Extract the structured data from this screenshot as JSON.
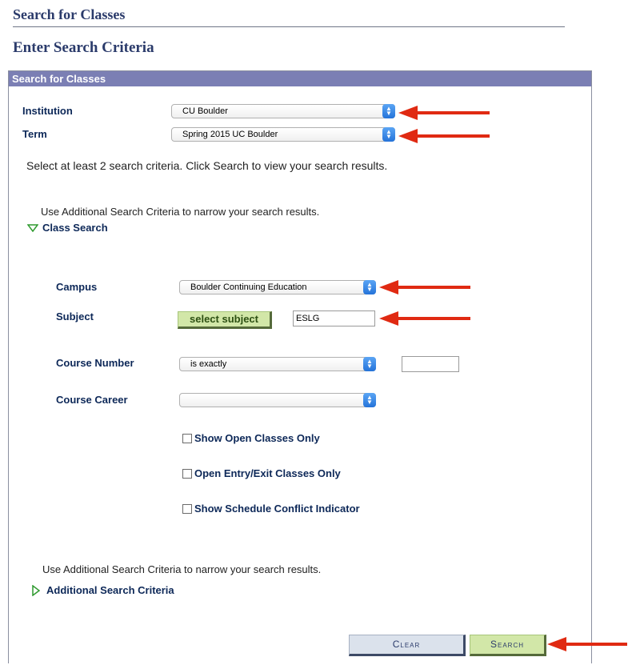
{
  "page": {
    "heading": "Search for Classes",
    "subheading": "Enter Search Criteria"
  },
  "panel": {
    "header": "Search for Classes",
    "institution": {
      "label": "Institution",
      "value": "CU Boulder"
    },
    "term": {
      "label": "Term",
      "value": "Spring 2015 UC Boulder"
    },
    "instruction": "Select at least 2 search criteria. Click Search to view your search results.",
    "additional_note_top": "Use Additional Search Criteria to narrow your search results.",
    "class_search_toggle": "Class Search",
    "campus": {
      "label": "Campus",
      "value": "Boulder Continuing Education"
    },
    "subject": {
      "label": "Subject",
      "button": "select subject",
      "value": "ESLG"
    },
    "course_number": {
      "label": "Course Number",
      "operator": "is exactly",
      "value": ""
    },
    "course_career": {
      "label": "Course Career",
      "value": ""
    },
    "checkboxes": {
      "open_only": "Show Open Classes Only",
      "open_entry_exit": "Open Entry/Exit Classes Only",
      "schedule_conflict": "Show Schedule Conflict Indicator"
    },
    "additional_note_bottom": "Use Additional Search Criteria to narrow your search results.",
    "additional_toggle": "Additional Search Criteria",
    "buttons": {
      "clear": "Clear",
      "search": "Search"
    }
  },
  "colors": {
    "panel_header": "#7b7fb4",
    "label": "#0d2858",
    "green_button": "#d2e7a8",
    "annotation_arrow": "#e02a12"
  }
}
